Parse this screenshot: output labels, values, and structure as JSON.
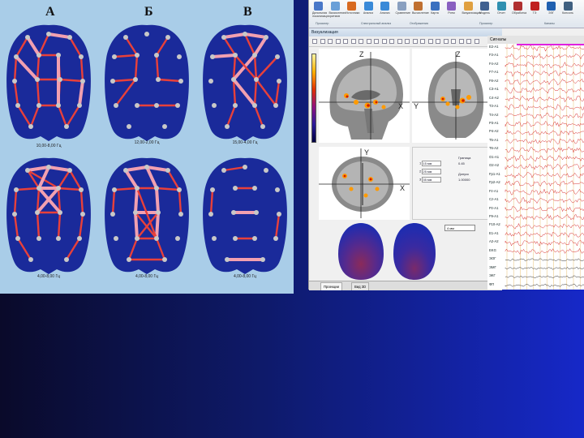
{
  "figure_labels": {
    "col_a": "А",
    "col_b": "Б",
    "col_c": "В"
  },
  "brain_captions": [
    "10,00-8,00 Гц",
    "12,00-2,00 Гц",
    "15,00-4,00 Гц",
    "4,00-8,00 Гц",
    "4,00-8,00 Гц",
    "4,00-8,00 Гц"
  ],
  "colors": {
    "slide_bg_left": "#0a0a2a",
    "slide_bg_right": "#1628c8",
    "panel_bg": "#a9cde8",
    "brain_fill": "#1a2a9a",
    "electrode": "#c8c8c8",
    "link_strong": "#e8403a",
    "link_weak": "#f2a0b0",
    "eeg_trace": "#d21818"
  },
  "app": {
    "ribbon_buttons": [
      {
        "label": "Дипольная локализация",
        "icon": "magnifier-icon"
      },
      {
        "label": "Вычисление ритмов",
        "icon": "person-icon"
      },
      {
        "label": "Источники",
        "icon": "fire-icon"
      },
      {
        "label": "Анализ",
        "icon": "globe-icon"
      },
      {
        "label": "Анализ",
        "icon": "globe-icon"
      },
      {
        "label": "Сравнение",
        "icon": "document-icon"
      },
      {
        "label": "Вычисление",
        "icon": "book-icon"
      },
      {
        "label": "Карта",
        "icon": "chart-icon"
      },
      {
        "label": "Ритм",
        "icon": "wave-icon"
      },
      {
        "label": "Визуализация",
        "icon": "head-icon"
      },
      {
        "label": "Модель",
        "icon": "chart-icon"
      },
      {
        "label": "Отчет",
        "icon": "wave-icon"
      },
      {
        "label": "Обработка",
        "icon": "gear-icon"
      },
      {
        "label": "ТЭ",
        "icon": "cross-icon"
      },
      {
        "label": "ЭЭГ",
        "icon": "magnifier-icon"
      },
      {
        "label": "Консоль",
        "icon": "screen-icon"
      }
    ],
    "ribbon_groups": [
      "Просмотр",
      "Спектральный анализ",
      "Отображения",
      "Просмотр",
      "Каналы"
    ],
    "visualization_title": "Визуализация",
    "eeg_title": "Сигналы",
    "axis_labels": {
      "z": "Z",
      "x": "X",
      "y": "Y"
    },
    "source_rows": [
      {
        "label": "1",
        "field": "15 мм"
      },
      {
        "label": "2",
        "field": "25 мм"
      },
      {
        "label": "3",
        "field": "35 мм"
      }
    ],
    "source_params": {
      "param1_label": "Граница",
      "param1_value": "0.45",
      "param2_label": "Допуск",
      "param2_value": "1.00000"
    },
    "dropdown_value": "4 мм",
    "tabs": [
      "Проекции",
      "Вид 3D"
    ]
  },
  "eeg_channels": [
    "E2-A1",
    "F3-A1",
    "F4-A2",
    "F7-A1",
    "F8-A2",
    "C3-A1",
    "C4-A2",
    "T3-A1",
    "T4-A2",
    "P3-A1",
    "P4-A2",
    "T5-A1",
    "T6-A2",
    "O1-A1",
    "O2-A2",
    "Fp1-A1",
    "Fp2-A2",
    "Fz-A1",
    "Cz-A1",
    "Pz-A1",
    "F9-A1",
    "F10-A2",
    "E1-A1",
    "A2-A2",
    "EKG",
    "ЭОГ",
    "ЭМГ",
    "ЭКГ",
    "ФП"
  ]
}
